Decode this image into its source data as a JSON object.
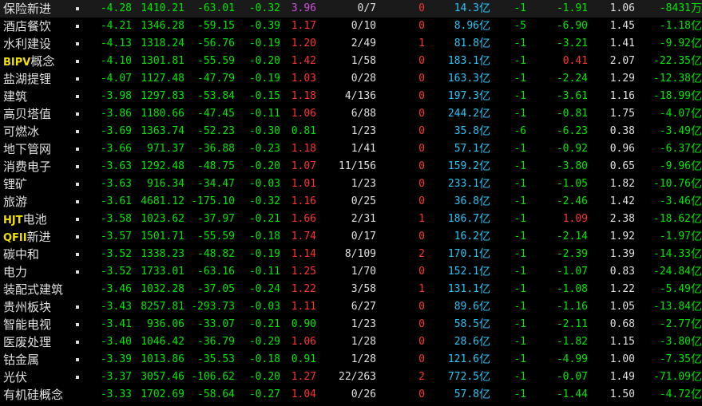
{
  "colors": {
    "up": "#ff3232",
    "down": "#00e600",
    "flat": "#e0e0e0",
    "text": "#e0e0e0",
    "amount": "#29c5f6",
    "special": "#d24ee0",
    "prefix": "#f0e000"
  },
  "rows": [
    {
      "name": "保险新进",
      "chg": "-4.28",
      "price": "1410.21",
      "cv": "-63.01",
      "sp": "-0.32",
      "vr": "3.96",
      "vr_c": "special",
      "ud": "0/7",
      "lim": "0",
      "lim_c": "up",
      "amt": "14.3",
      "c1": "-1",
      "c2": "-1.91",
      "c2_c": "down",
      "c3": "1.06",
      "flow": "-8431",
      "unit": "万"
    },
    {
      "name": "酒店餐饮",
      "chg": "-4.21",
      "price": "1346.28",
      "cv": "-59.15",
      "sp": "-0.39",
      "vr": "1.17",
      "vr_c": "up",
      "ud": "0/10",
      "lim": "0",
      "lim_c": "up",
      "amt": "8.96",
      "c1": "-5",
      "c2": "-6.90",
      "c2_c": "down",
      "c3": "1.45",
      "flow": "-1.18",
      "unit": "亿"
    },
    {
      "name": "水利建设",
      "chg": "-4.13",
      "price": "1318.24",
      "cv": "-56.76",
      "sp": "-0.19",
      "vr": "1.20",
      "vr_c": "up",
      "ud": "2/49",
      "lim": "1",
      "lim_c": "up",
      "amt": "81.8",
      "c1": "-1",
      "c2": "-3.21",
      "c2_c": "down",
      "c3": "1.41",
      "flow": "-9.92",
      "unit": "亿"
    },
    {
      "prefix": "BIPV",
      "name": "概念",
      "chg": "-4.10",
      "price": "1301.81",
      "cv": "-55.59",
      "sp": "-0.20",
      "vr": "1.42",
      "vr_c": "up",
      "ud": "1/58",
      "lim": "0",
      "lim_c": "up",
      "amt": "183.1",
      "c1": "-1",
      "c2": "0.41",
      "c2_c": "up",
      "c3": "2.07",
      "flow": "-22.35",
      "unit": "亿"
    },
    {
      "name": "盐湖提锂",
      "chg": "-4.07",
      "price": "1127.48",
      "cv": "-47.79",
      "sp": "-0.19",
      "vr": "1.03",
      "vr_c": "up",
      "ud": "0/28",
      "lim": "0",
      "lim_c": "up",
      "amt": "163.3",
      "c1": "-1",
      "c2": "-2.24",
      "c2_c": "down",
      "c3": "1.29",
      "flow": "-12.38",
      "unit": "亿"
    },
    {
      "name": "建筑",
      "chg": "-3.98",
      "price": "1297.83",
      "cv": "-53.84",
      "sp": "-0.15",
      "vr": "1.18",
      "vr_c": "up",
      "ud": "4/136",
      "lim": "0",
      "lim_c": "up",
      "amt": "197.3",
      "c1": "-1",
      "c2": "-3.61",
      "c2_c": "down",
      "c3": "1.16",
      "flow": "-18.99",
      "unit": "亿"
    },
    {
      "name": "高贝塔值",
      "chg": "-3.86",
      "price": "1180.66",
      "cv": "-47.45",
      "sp": "-0.11",
      "vr": "1.06",
      "vr_c": "up",
      "ud": "6/88",
      "lim": "0",
      "lim_c": "up",
      "amt": "244.2",
      "c1": "-1",
      "c2": "-0.81",
      "c2_c": "down",
      "c3": "1.75",
      "flow": "-4.07",
      "unit": "亿"
    },
    {
      "name": "可燃冰",
      "chg": "-3.69",
      "price": "1363.74",
      "cv": "-52.23",
      "sp": "-0.30",
      "vr": "0.81",
      "vr_c": "down",
      "ud": "1/23",
      "lim": "0",
      "lim_c": "up",
      "amt": "35.8",
      "c1": "-6",
      "c2": "-6.23",
      "c2_c": "down",
      "c3": "0.38",
      "flow": "-3.49",
      "unit": "亿"
    },
    {
      "name": "地下管网",
      "chg": "-3.66",
      "price": "971.37",
      "cv": "-36.88",
      "sp": "-0.23",
      "vr": "1.18",
      "vr_c": "up",
      "ud": "1/41",
      "lim": "0",
      "lim_c": "up",
      "amt": "57.1",
      "c1": "-1",
      "c2": "-0.92",
      "c2_c": "down",
      "c3": "0.96",
      "flow": "-6.37",
      "unit": "亿"
    },
    {
      "name": "消费电子",
      "chg": "-3.63",
      "price": "1292.48",
      "cv": "-48.75",
      "sp": "-0.20",
      "vr": "1.07",
      "vr_c": "up",
      "ud": "11/156",
      "lim": "0",
      "lim_c": "up",
      "amt": "159.2",
      "c1": "-1",
      "c2": "-3.80",
      "c2_c": "down",
      "c3": "0.65",
      "flow": "-9.96",
      "unit": "亿"
    },
    {
      "name": "锂矿",
      "chg": "-3.63",
      "price": "916.34",
      "cv": "-34.47",
      "sp": "-0.03",
      "vr": "1.01",
      "vr_c": "up",
      "ud": "1/23",
      "lim": "0",
      "lim_c": "up",
      "amt": "233.1",
      "c1": "-1",
      "c2": "-1.05",
      "c2_c": "down",
      "c3": "1.82",
      "flow": "-10.76",
      "unit": "亿"
    },
    {
      "name": "旅游",
      "chg": "-3.61",
      "price": "4681.12",
      "cv": "-175.10",
      "sp": "-0.32",
      "vr": "1.16",
      "vr_c": "up",
      "ud": "0/25",
      "lim": "0",
      "lim_c": "up",
      "amt": "36.8",
      "c1": "-1",
      "c2": "-2.46",
      "c2_c": "down",
      "c3": "1.42",
      "flow": "-3.46",
      "unit": "亿"
    },
    {
      "prefix": "HJT",
      "name": "电池",
      "chg": "-3.58",
      "price": "1023.62",
      "cv": "-37.97",
      "sp": "-0.21",
      "vr": "1.66",
      "vr_c": "up",
      "ud": "2/31",
      "lim": "1",
      "lim_c": "up",
      "amt": "186.7",
      "c1": "-1",
      "c2": "1.09",
      "c2_c": "up",
      "c3": "2.38",
      "flow": "-18.62",
      "unit": "亿"
    },
    {
      "prefix": "QFII",
      "name": "新进",
      "chg": "-3.57",
      "price": "1501.71",
      "cv": "-55.59",
      "sp": "-0.18",
      "vr": "1.74",
      "vr_c": "up",
      "ud": "0/17",
      "lim": "0",
      "lim_c": "up",
      "amt": "16.2",
      "c1": "-1",
      "c2": "-2.14",
      "c2_c": "down",
      "c3": "1.92",
      "flow": "-1.97",
      "unit": "亿"
    },
    {
      "name": "碳中和",
      "chg": "-3.52",
      "price": "1338.23",
      "cv": "-48.82",
      "sp": "-0.19",
      "vr": "1.14",
      "vr_c": "up",
      "ud": "8/109",
      "lim": "2",
      "lim_c": "up",
      "amt": "170.1",
      "c1": "-1",
      "c2": "-2.39",
      "c2_c": "down",
      "c3": "1.39",
      "flow": "-14.33",
      "unit": "亿"
    },
    {
      "name": "电力",
      "chg": "-3.52",
      "price": "1733.01",
      "cv": "-63.16",
      "sp": "-0.11",
      "vr": "1.25",
      "vr_c": "up",
      "ud": "1/70",
      "lim": "0",
      "lim_c": "up",
      "amt": "152.1",
      "c1": "-1",
      "c2": "-1.07",
      "c2_c": "down",
      "c3": "0.83",
      "flow": "-24.84",
      "unit": "亿"
    },
    {
      "name": "装配式建筑",
      "chg": "-3.46",
      "price": "1032.28",
      "cv": "-37.05",
      "sp": "-0.24",
      "vr": "1.22",
      "vr_c": "up",
      "ud": "3/58",
      "lim": "1",
      "lim_c": "up",
      "amt": "131.1",
      "c1": "-1",
      "c2": "-1.08",
      "c2_c": "down",
      "c3": "1.22",
      "flow": "-5.49",
      "unit": "亿"
    },
    {
      "name": "贵州板块",
      "chg": "-3.43",
      "price": "8257.81",
      "cv": "-293.73",
      "sp": "-0.03",
      "vr": "1.11",
      "vr_c": "up",
      "ud": "6/27",
      "lim": "0",
      "lim_c": "up",
      "amt": "89.6",
      "c1": "-1",
      "c2": "-1.16",
      "c2_c": "down",
      "c3": "1.05",
      "flow": "-13.84",
      "unit": "亿"
    },
    {
      "name": "智能电视",
      "chg": "-3.41",
      "price": "936.06",
      "cv": "-33.07",
      "sp": "-0.21",
      "vr": "0.90",
      "vr_c": "down",
      "ud": "1/23",
      "lim": "0",
      "lim_c": "up",
      "amt": "58.5",
      "c1": "-1",
      "c2": "-2.11",
      "c2_c": "down",
      "c3": "0.68",
      "flow": "-2.77",
      "unit": "亿"
    },
    {
      "name": "医废处理",
      "chg": "-3.40",
      "price": "1046.42",
      "cv": "-36.79",
      "sp": "-0.29",
      "vr": "1.06",
      "vr_c": "up",
      "ud": "1/28",
      "lim": "0",
      "lim_c": "up",
      "amt": "28.6",
      "c1": "-1",
      "c2": "-1.82",
      "c2_c": "down",
      "c3": "1.15",
      "flow": "-3.80",
      "unit": "亿"
    },
    {
      "name": "钴金属",
      "chg": "-3.39",
      "price": "1013.86",
      "cv": "-35.53",
      "sp": "-0.18",
      "vr": "0.91",
      "vr_c": "down",
      "ud": "1/28",
      "lim": "0",
      "lim_c": "up",
      "amt": "121.6",
      "c1": "-1",
      "c2": "-4.99",
      "c2_c": "down",
      "c3": "1.00",
      "flow": "-7.35",
      "unit": "亿"
    },
    {
      "name": "光伏",
      "chg": "-3.37",
      "price": "3057.46",
      "cv": "-106.62",
      "sp": "-0.20",
      "vr": "1.27",
      "vr_c": "up",
      "ud": "22/263",
      "lim": "2",
      "lim_c": "up",
      "amt": "772.5",
      "c1": "-1",
      "c2": "-0.07",
      "c2_c": "down",
      "c3": "1.49",
      "flow": "-71.09",
      "unit": "亿"
    },
    {
      "name": "有机硅概念",
      "chg": "-3.33",
      "price": "1702.69",
      "cv": "-58.64",
      "sp": "-0.27",
      "vr": "1.04",
      "vr_c": "up",
      "ud": "0/26",
      "lim": "0",
      "lim_c": "up",
      "amt": "57.8",
      "c1": "-1",
      "c2": "-1.44",
      "c2_c": "down",
      "c3": "1.50",
      "flow": "-4.72",
      "unit": "亿"
    }
  ],
  "amount_unit": "亿"
}
